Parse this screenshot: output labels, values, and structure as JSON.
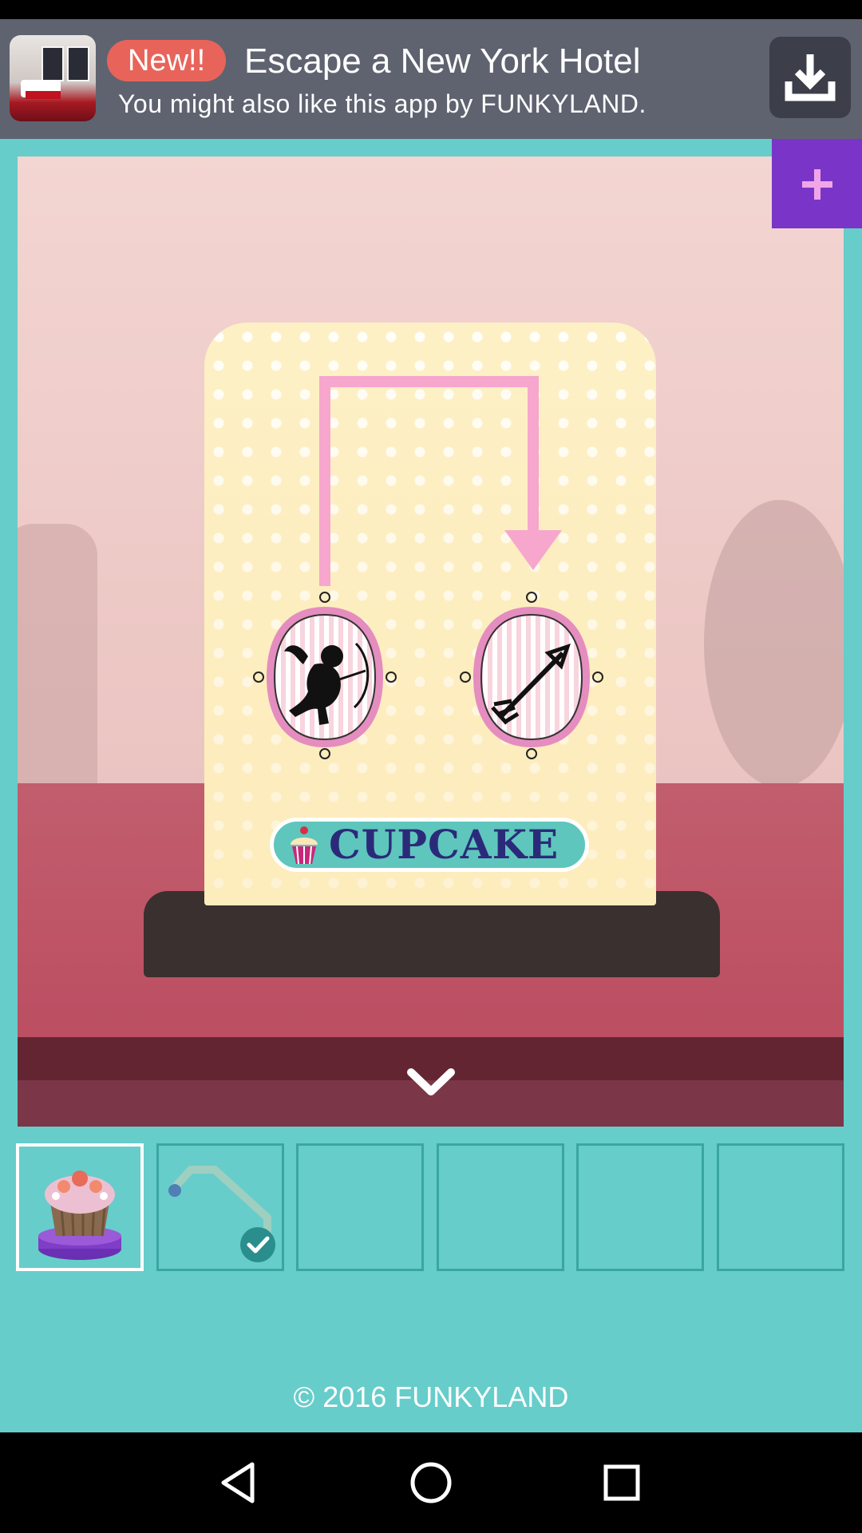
{
  "ad": {
    "badge": "New!!",
    "title": "Escape a New York Hotel",
    "subtitle": "You might also like this app by FUNKYLAND.",
    "thumbnail_icon": "hotel-room-thumbnail",
    "download_icon": "download-icon"
  },
  "toolbar": {
    "plus_icon": "plus-icon",
    "plus_color": "#7a35c8"
  },
  "scene": {
    "sign_label": "CUPCAKE",
    "left_emblem_icon": "cupid-silhouette-icon",
    "right_emblem_icon": "arrow-icon",
    "hint_arrow_icon": "pink-path-arrow",
    "expand_icon": "chevron-down-icon"
  },
  "inventory": {
    "slots": [
      {
        "item": "cupcake",
        "selected": true
      },
      {
        "item": "bent-pipe",
        "checked": true
      },
      {
        "item": ""
      },
      {
        "item": ""
      },
      {
        "item": ""
      },
      {
        "item": ""
      }
    ]
  },
  "footer": {
    "copyright": "© 2016 FUNKYLAND"
  },
  "navbar": {
    "back_icon": "back-triangle-icon",
    "home_icon": "home-circle-icon",
    "recents_icon": "recents-square-icon"
  },
  "colors": {
    "background": "#66cdca",
    "ad_banner": "#5f6370",
    "badge": "#e8645a",
    "table": "#bd5164"
  }
}
